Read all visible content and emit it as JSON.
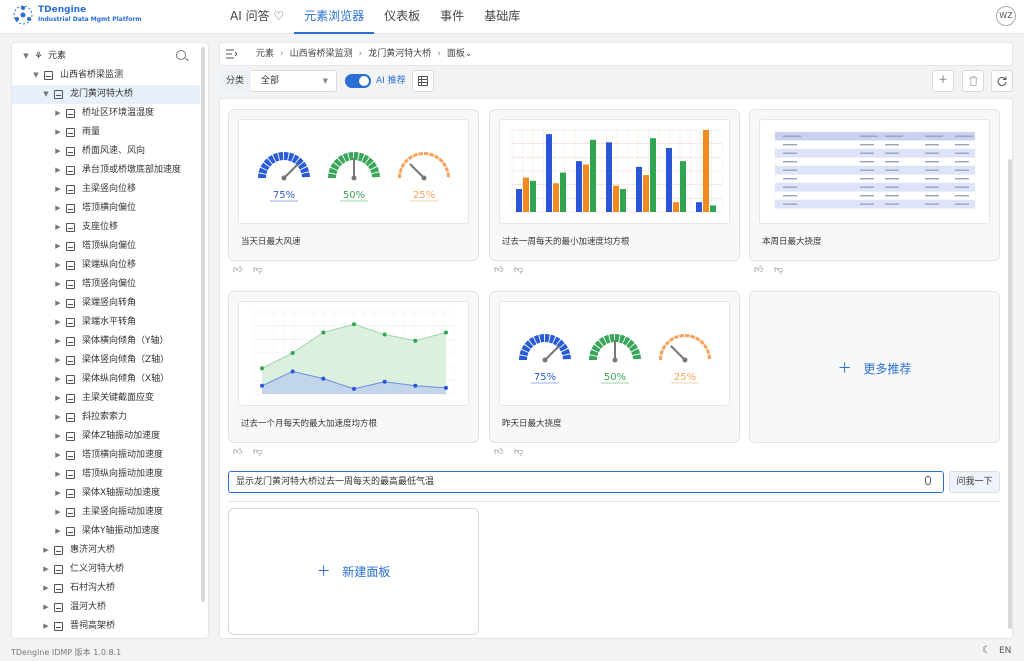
{
  "app": {
    "logo_name": "TDengine",
    "logo_sub": "Industrial Data Mgmt Platform",
    "user_initials": "WZ"
  },
  "nav": {
    "items": [
      {
        "label": "AI 问答 ♡"
      },
      {
        "label": "元素浏览器"
      },
      {
        "label": "仪表板"
      },
      {
        "label": "事件"
      },
      {
        "label": "基础库"
      }
    ],
    "active_index": 1
  },
  "sidebar": {
    "root_label": "元素",
    "tree": [
      {
        "label": "山西省桥梁监测",
        "level": 1,
        "expanded": true
      },
      {
        "label": "龙门黄河特大桥",
        "level": 2,
        "expanded": true,
        "selected": true
      },
      {
        "label": "桥址区环境温湿度",
        "level": 3
      },
      {
        "label": "雨量",
        "level": 3
      },
      {
        "label": "桥面风速、风向",
        "level": 3
      },
      {
        "label": "承台顶或桥墩底部加速度",
        "level": 3
      },
      {
        "label": "主梁竖向位移",
        "level": 3
      },
      {
        "label": "塔顶横向偏位",
        "level": 3
      },
      {
        "label": "支座位移",
        "level": 3
      },
      {
        "label": "塔顶纵向偏位",
        "level": 3
      },
      {
        "label": "梁端纵向位移",
        "level": 3
      },
      {
        "label": "塔顶竖向偏位",
        "level": 3
      },
      {
        "label": "梁端竖向转角",
        "level": 3
      },
      {
        "label": "梁端水平转角",
        "level": 3
      },
      {
        "label": "梁体横向倾角（Y轴）",
        "level": 3
      },
      {
        "label": "梁体竖向倾角（Z轴）",
        "level": 3
      },
      {
        "label": "梁体纵向倾角（X轴）",
        "level": 3
      },
      {
        "label": "主梁关键截面应变",
        "level": 3
      },
      {
        "label": "斜拉索索力",
        "level": 3
      },
      {
        "label": "梁体Z轴振动加速度",
        "level": 3
      },
      {
        "label": "塔顶横向振动加速度",
        "level": 3
      },
      {
        "label": "塔顶纵向振动加速度",
        "level": 3
      },
      {
        "label": "梁体X轴振动加速度",
        "level": 3
      },
      {
        "label": "主梁竖向振动加速度",
        "level": 3
      },
      {
        "label": "梁体Y轴振动加速度",
        "level": 3
      },
      {
        "label": "惠济河大桥",
        "level": 2
      },
      {
        "label": "仁义河特大桥",
        "level": 2
      },
      {
        "label": "石村沟大桥",
        "level": 2
      },
      {
        "label": "温河大桥",
        "level": 2
      },
      {
        "label": "晋祠高架桥",
        "level": 2
      }
    ]
  },
  "breadcrumb": [
    "元素",
    "山西省桥梁监测",
    "龙门黄河特大桥",
    "面板"
  ],
  "toolbar": {
    "category_label": "分类",
    "category_value": "全部",
    "ai_recommend_label": "AI 推荐",
    "ai_recommend_on": true
  },
  "cards": [
    {
      "title": "当天日最大风速",
      "type": "gauges"
    },
    {
      "title": "过去一周每天的最小加速度均方根",
      "type": "bar"
    },
    {
      "title": "本周日最大挠度",
      "type": "table"
    },
    {
      "title": "过去一个月每天的最大加速度均方根",
      "type": "area"
    },
    {
      "title": "昨天日最大挠度",
      "type": "gauges"
    }
  ],
  "more_card_label": "更多推荐",
  "ask": {
    "input_value": "显示龙门黄河特大桥过去一周每天的最高最低气温",
    "button_label": "问我一下"
  },
  "new_panel_label": "新建面板",
  "footer": {
    "version": "TDengine IDMP 版本 1.0.8.1",
    "lang": "EN"
  },
  "colors": {
    "accent": "#2b6fd6",
    "gauge_blue": "#2a5bd7",
    "gauge_green": "#3aa65a",
    "gauge_orange": "#f5a35c",
    "bar_blue": "#2b55d8",
    "bar_orange": "#f28a22",
    "bar_green": "#2fa552"
  },
  "chart_data": [
    {
      "type": "gauge",
      "values": [
        "75%",
        "50%",
        "25%"
      ],
      "percent": [
        75,
        50,
        25
      ]
    },
    {
      "type": "bar",
      "series": [
        {
          "values": [
            28,
            95,
            62,
            85,
            55,
            78,
            12
          ]
        },
        {
          "values": [
            42,
            35,
            58,
            32,
            45,
            12,
            100
          ]
        },
        {
          "values": [
            38,
            48,
            88,
            28,
            90,
            62,
            8
          ]
        }
      ],
      "ylim": [
        0,
        100
      ]
    },
    {
      "type": "area",
      "series": [
        {
          "values": [
            25,
            40,
            60,
            68,
            58,
            52,
            60
          ]
        },
        {
          "values": [
            8,
            22,
            15,
            5,
            12,
            8,
            6
          ]
        }
      ],
      "ylim": [
        0,
        80
      ]
    },
    {
      "type": "gauge",
      "values": [
        "75%",
        "50%",
        "25%"
      ],
      "percent": [
        75,
        50,
        25
      ]
    }
  ]
}
